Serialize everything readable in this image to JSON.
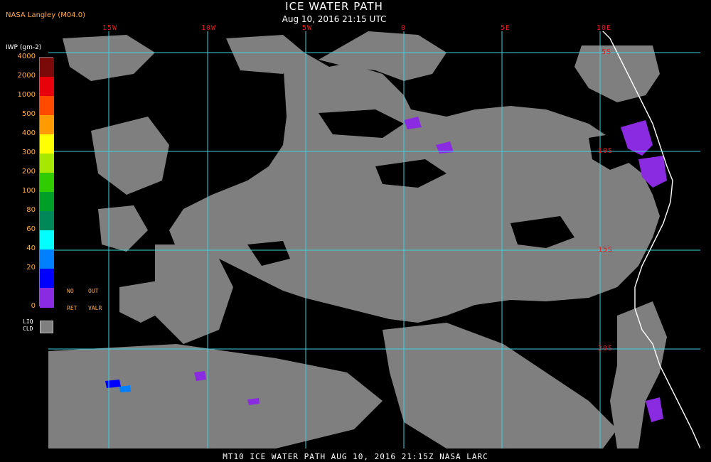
{
  "header": {
    "title": "ICE WATER PATH",
    "subtitle": "Aug 10, 2016 21:15 UTC",
    "source": "NASA Langley (M04.0)"
  },
  "footer": {
    "text": "MT10  ICE WATER PATH   AUG 10, 2016 21:15Z   NASA LARC"
  },
  "legend": {
    "title": "IWP (gm-2)",
    "entries": [
      {
        "value": "4000",
        "color": "#7a0a0a"
      },
      {
        "value": "2000",
        "color": "#e8000a"
      },
      {
        "value": "1000",
        "color": "#ff4a00"
      },
      {
        "value": "500",
        "color": "#ff9a00"
      },
      {
        "value": "400",
        "color": "#ffff00"
      },
      {
        "value": "300",
        "color": "#a8e800"
      },
      {
        "value": "200",
        "color": "#30cc00"
      },
      {
        "value": "100",
        "color": "#00a028"
      },
      {
        "value": "80",
        "color": "#008858"
      },
      {
        "value": "60",
        "color": "#00ffff"
      },
      {
        "value": "40",
        "color": "#0080ff"
      },
      {
        "value": "20",
        "color": "#0000ff"
      },
      {
        "value": "0",
        "color": "#8a2be2"
      }
    ],
    "no_ret": {
      "line1": "NO",
      "line2": "RET"
    },
    "out_valr": {
      "line1": "OUT",
      "line2": "VALR"
    },
    "liq_cld": {
      "line1": "LIQ",
      "line2": "CLD",
      "color": "#7f7f7f"
    }
  },
  "grid": {
    "color": "#40d0e0",
    "longitude_labels": [
      "15W",
      "10W",
      "5W",
      "0",
      "5E",
      "10E"
    ],
    "latitude_labels": [
      "5S",
      "10S",
      "15S",
      "20S"
    ]
  },
  "colors": {
    "background": "#000000",
    "liquid_cloud": "#7f7f7f",
    "coastline": "#ffffff",
    "label_orange": "#ffa94d",
    "label_red": "#e02020"
  }
}
